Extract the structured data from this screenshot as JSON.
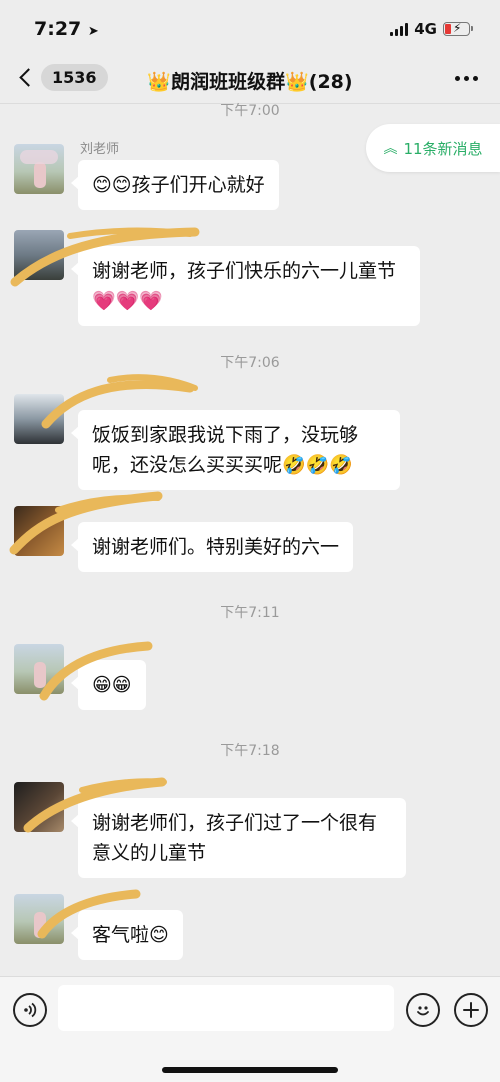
{
  "status_bar": {
    "time": "7:27",
    "network": "4G"
  },
  "nav": {
    "back_count": "1536",
    "title": "朗润班班级群",
    "member_count": "(28)"
  },
  "new_messages": {
    "label": "11条新消息"
  },
  "colors": {
    "bubble": "#ffffff",
    "background": "#ededed",
    "accent_green": "#2aae67",
    "scribble": "#e9b85a"
  },
  "timestamps": {
    "t0": "下午7:00",
    "t1": "下午7:06",
    "t2": "下午7:11",
    "t3": "下午7:18"
  },
  "messages": [
    {
      "sender": "刘老师",
      "text": "孩子们开心就好",
      "emoji_before": "😊😊"
    },
    {
      "sender": "",
      "text": "谢谢老师，孩子们快乐的六一儿童节",
      "emoji_after": "💗💗💗"
    },
    {
      "sender": "",
      "text": "饭饭到家跟我说下雨了，没玩够呢，还没怎么买买买呢",
      "emoji_after": "🤣🤣🤣"
    },
    {
      "sender": "",
      "text": "谢谢老师们。特别美好的六一"
    },
    {
      "sender": "",
      "text": "",
      "emoji_before": "😁😁"
    },
    {
      "sender": "",
      "text": "谢谢老师们，孩子们过了一个很有意义的儿童节"
    },
    {
      "sender": "",
      "text": "客气啦",
      "emoji_after": "😊"
    }
  ],
  "icons": {
    "back": "chevron-left-icon",
    "more": "more-dots-icon",
    "voice": "voice-icon",
    "emoji": "emoji-icon",
    "plus": "plus-icon"
  }
}
